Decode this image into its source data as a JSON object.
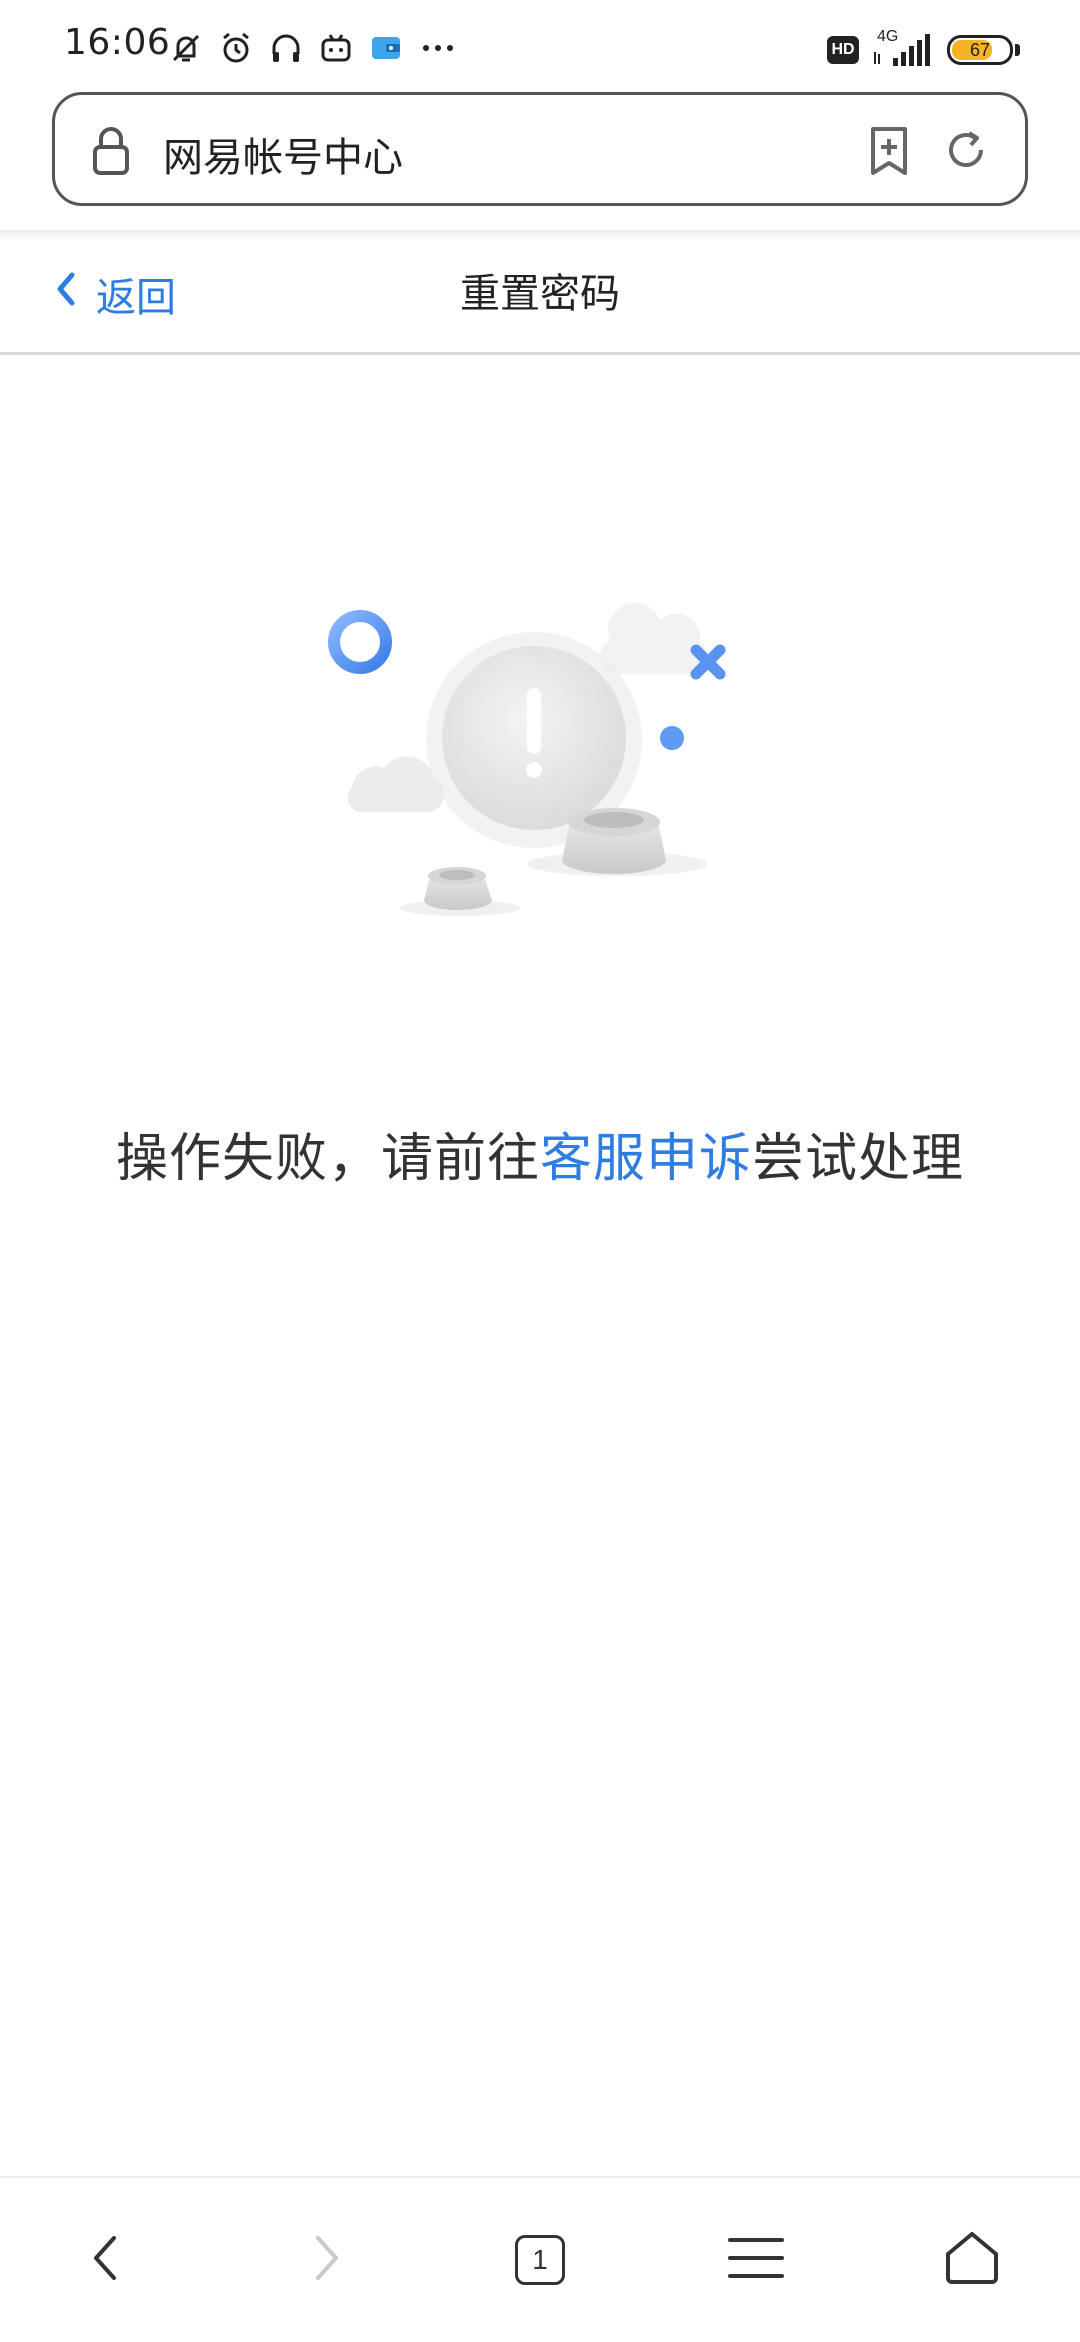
{
  "status_bar": {
    "time": "16:06",
    "icons": [
      "mute-vibrate-icon",
      "alarm-icon",
      "headphones-icon",
      "bilibili-icon",
      "wallet-icon",
      "more-dots-icon"
    ],
    "hd_label": "HD",
    "network_label": "4G",
    "battery_level": "67"
  },
  "address_bar": {
    "site_title": "网易帐号中心",
    "icons": [
      "lock-icon",
      "add-bookmark-icon",
      "reload-icon"
    ]
  },
  "page_header": {
    "back_label": "返回",
    "title": "重置密码"
  },
  "message": {
    "prefix": "操作失败，请前往",
    "link_text": "客服申诉",
    "suffix": "尝试处理"
  },
  "bottom_nav": {
    "tab_count": "1",
    "icons": [
      "back-arrow-icon",
      "forward-arrow-icon",
      "tabs-icon",
      "menu-icon",
      "home-icon"
    ]
  },
  "colors": {
    "accent": "#2f7de1",
    "battery": "#f5b326"
  }
}
